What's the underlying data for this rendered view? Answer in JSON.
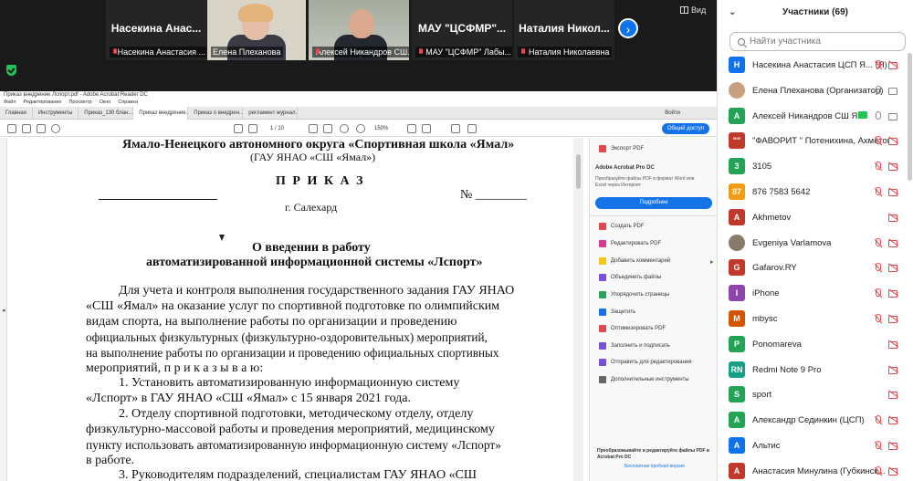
{
  "gallery": {
    "tiles": [
      {
        "name": "Насекина  Анас...",
        "label": "Насекина Анастасия ..."
      },
      {
        "name": "",
        "label": "Елена Плеханова"
      },
      {
        "name": "",
        "label": "Алексей Никандров СШ..."
      },
      {
        "name": "МАУ  \"ЦСФМР\"...",
        "label": "МАУ \"ЦСФМР\" Лабы..."
      },
      {
        "name": "Наталия  Никол...",
        "label": "Наталия Николаевна"
      }
    ],
    "next_icon": "›",
    "view_label": "Вид"
  },
  "acrobat": {
    "title": "Приказ внедрение Лспорт.pdf - Adobe Acrobat Reader DC",
    "menu": [
      "Файл",
      "Редактирование",
      "Просмотр",
      "Окно",
      "Справка"
    ],
    "tabs": [
      "Главная",
      "Инструменты",
      "Приказ_130 блан...",
      "Приказ внедрение...",
      "Приказ о внедрен...",
      "регламент журнал..."
    ],
    "active_tab": 3,
    "signin": "Войти",
    "share_label": "Общий доступ",
    "page_current": "1",
    "page_total": "/ 10",
    "zoom": "150%"
  },
  "document": {
    "header1": "Ямало-Ненецкого автономного округа «Спортивная школа «Ямал»",
    "header2": "(ГАУ ЯНАО «СШ «Ямал»)",
    "title": "П Р И К А З",
    "number_prefix": "№",
    "city": "г. Салехард",
    "subject1": "О введении в работу",
    "subject2": "автоматизированной информационной системы «Лспорт»",
    "body": [
      "Для учета и контроля выполнения государственного задания ГАУ ЯНАО",
      "«СШ «Ямал» на оказание услуг по спортивной подготовке по олимпийским",
      "видам спорта, на выполнение работы по организации и проведению",
      "официальных физкультурных (физкультурно-оздоровительных) мероприятий,",
      "на выполнение работы по организации и проведению официальных спортивных",
      "мероприятий, п р и к а з ы в а ю:",
      "1.     Установить     автоматизированную     информационную     систему",
      "«Лспорт» в ГАУ ЯНАО «СШ «Ямал» с 15 января 2021 года.",
      "2.     Отделу спортивной подготовки, методическому отделу, отделу",
      "физкультурно-массовой работы и проведения мероприятий, медицинскому",
      "пункту использовать автоматизированную информационную систему «Лспорт»",
      "в работе.",
      "3.     Руководителям подразделений, специалистам ГАУ ЯНАО «СШ"
    ]
  },
  "right_pane": {
    "export_label": "Экспорт PDF",
    "promo_title": "Adobe Acrobat Pro DC",
    "promo_text": "Преобразуйте файлы PDF в формат Word или Excel через Интернет",
    "upgrade_label": "Подробнее",
    "tools": [
      "Создать PDF",
      "Редактировать PDF",
      "Добавить комментарий",
      "Объединить файлы",
      "Упорядочить страницы",
      "Защитить",
      "Оптимизировать PDF",
      "Заполнить и подписать",
      "Отправить для редактирования",
      "Дополнительные инструменты"
    ],
    "footer1": "Преобразовывайте и редактируйте файлы PDF в Acrobat Pro DC",
    "footer2": "Бесплатная пробная версия"
  },
  "participants": {
    "title": "Участники (69)",
    "search_placeholder": "Найти участника",
    "list": [
      {
        "initial": "Н",
        "color": "#0e72ed",
        "name": "Насекина Анастасия ЦСП Я... (Я)",
        "mic": "off",
        "cam": "off"
      },
      {
        "initial": "",
        "color": "#c8a080",
        "name": "Елена Плеханова (Организатор)",
        "mic": "on",
        "cam": "on"
      },
      {
        "initial": "А",
        "color": "#23a455",
        "name": "Алексей Никандров СШ Я...",
        "mic": "on",
        "cam": "on"
      },
      {
        "initial": "\"\"",
        "color": "#c0392b",
        "name": "\"ФАВОРИТ \" Потенихина, Ахметов, ...",
        "mic": "off",
        "cam": "off"
      },
      {
        "initial": "3",
        "color": "#23a455",
        "name": "3105",
        "mic": "off",
        "cam": "off"
      },
      {
        "initial": "87",
        "color": "#f39c12",
        "name": "876 7583 5642",
        "mic": "off",
        "cam": "off"
      },
      {
        "initial": "A",
        "color": "#c0392b",
        "name": "Akhmetov",
        "mic": "none",
        "cam": "off"
      },
      {
        "initial": "",
        "color": "#8a7a6a",
        "name": "Evgeniya Varlamova",
        "mic": "off",
        "cam": "off"
      },
      {
        "initial": "G",
        "color": "#c0392b",
        "name": "Gafarov.RY",
        "mic": "off",
        "cam": "off"
      },
      {
        "initial": "I",
        "color": "#8e44ad",
        "name": "iPhone",
        "mic": "off",
        "cam": "off"
      },
      {
        "initial": "M",
        "color": "#d35400",
        "name": "mbysc",
        "mic": "off",
        "cam": "off"
      },
      {
        "initial": "P",
        "color": "#23a455",
        "name": "Ponomareva",
        "mic": "none",
        "cam": "off"
      },
      {
        "initial": "RN",
        "color": "#16a085",
        "name": "Redmi Note 9 Pro",
        "mic": "none",
        "cam": "off"
      },
      {
        "initial": "S",
        "color": "#23a455",
        "name": "sport",
        "mic": "none",
        "cam": "off"
      },
      {
        "initial": "А",
        "color": "#23a455",
        "name": "Александр Сединкин (ЦСП)",
        "mic": "off",
        "cam": "off"
      },
      {
        "initial": "А",
        "color": "#0e72ed",
        "name": "Альтис",
        "mic": "off",
        "cam": "off"
      },
      {
        "initial": "А",
        "color": "#c0392b",
        "name": "Анастасия Минулина (Губкинск...",
        "mic": "off",
        "cam": "off"
      }
    ]
  }
}
